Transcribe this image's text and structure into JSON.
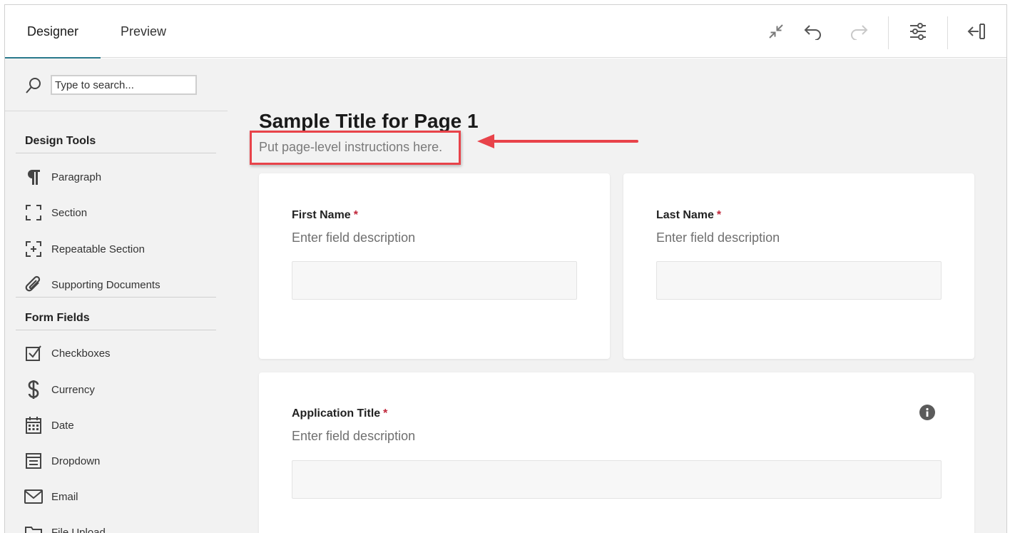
{
  "tabs": {
    "designer": "Designer",
    "preview": "Preview"
  },
  "toolbar": {
    "collapse_icon": "collapse-icon",
    "undo_icon": "undo-icon",
    "redo_icon": "redo-icon",
    "settings_icon": "sliders-icon",
    "panel_icon": "close-panel-icon"
  },
  "sidebar": {
    "search": {
      "placeholder": "Type to search..."
    },
    "design_tools": {
      "title": "Design Tools",
      "items": [
        {
          "label": "Paragraph",
          "icon": "paragraph-icon"
        },
        {
          "label": "Section",
          "icon": "section-icon"
        },
        {
          "label": "Repeatable Section",
          "icon": "repeatable-section-icon"
        },
        {
          "label": "Supporting Documents",
          "icon": "paperclip-icon"
        }
      ]
    },
    "form_fields": {
      "title": "Form Fields",
      "items": [
        {
          "label": "Checkboxes",
          "icon": "checkbox-icon"
        },
        {
          "label": "Currency",
          "icon": "dollar-icon"
        },
        {
          "label": "Date",
          "icon": "calendar-icon"
        },
        {
          "label": "Dropdown",
          "icon": "dropdown-icon"
        },
        {
          "label": "Email",
          "icon": "email-icon"
        },
        {
          "label": "File Upload",
          "icon": "folder-icon"
        }
      ]
    }
  },
  "page": {
    "title": "Sample Title for Page 1",
    "instructions": "Put page-level instructions here.",
    "fields": [
      {
        "label": "First Name",
        "required": "*",
        "description": "Enter field description"
      },
      {
        "label": "Last Name",
        "required": "*",
        "description": "Enter field description"
      },
      {
        "label": "Application Title",
        "required": "*",
        "description": "Enter field description"
      }
    ]
  },
  "colors": {
    "accent": "#2a7a8c",
    "highlight": "#e8434a",
    "required": "#c0263a"
  }
}
